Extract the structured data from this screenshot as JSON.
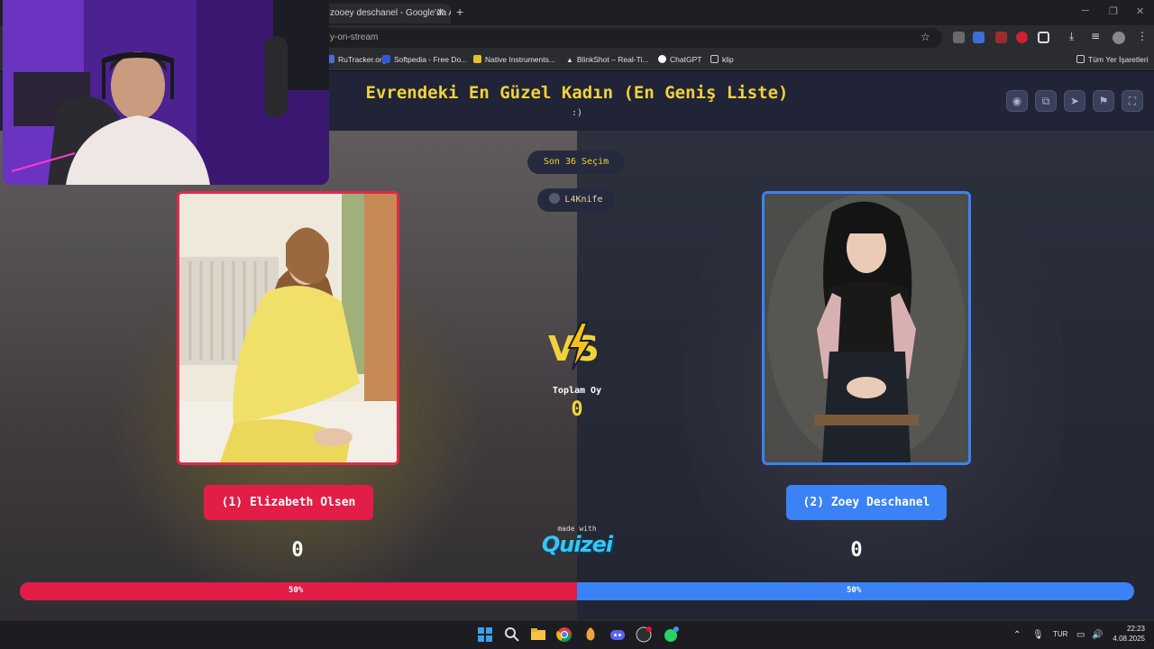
{
  "browser": {
    "tab_title": "zooey deschanel - Google'da A",
    "tab_close": "✕",
    "new_tab": "+",
    "url": "y-on-stream",
    "bookmarks": [
      {
        "label": "RuTracker.org",
        "color": "#4a6fd1"
      },
      {
        "label": "Softpedia - Free Do...",
        "color": "#2a5bd7"
      },
      {
        "label": "Native Instruments...",
        "color": "#e6c12a"
      },
      {
        "label": "BlinkShot – Real-Ti...",
        "color": "#ffffff"
      },
      {
        "label": "ChatGPT",
        "color": "#ffffff"
      },
      {
        "label": "klip",
        "color": "#9a9a9a"
      }
    ],
    "all_bookmarks": "Tüm Yer İşaretleri"
  },
  "page": {
    "title": "Evrendeki En Güzel Kadın (En Geniş Liste)",
    "subtitle": ":)",
    "recent_pill": "Son 36 Seçim",
    "user_pill": "L4Knife",
    "left_name": "(1) Elizabeth Olsen",
    "right_name": "(2) Zoey Deschanel",
    "left_score": "0",
    "right_score": "0",
    "vs_text": "VS",
    "total_label": "Toplam Oy",
    "total_value": "0",
    "made_with": "made with",
    "brand": "Quizei",
    "left_percent_label": "50%",
    "right_percent_label": "50%",
    "left_share": 0.5,
    "colors": {
      "accent": "#f2d23a",
      "left": "#e11d48",
      "right": "#3b82f6"
    }
  },
  "taskbar": {
    "language": "TUR",
    "time": "22:23",
    "date": "4.08.2025"
  }
}
